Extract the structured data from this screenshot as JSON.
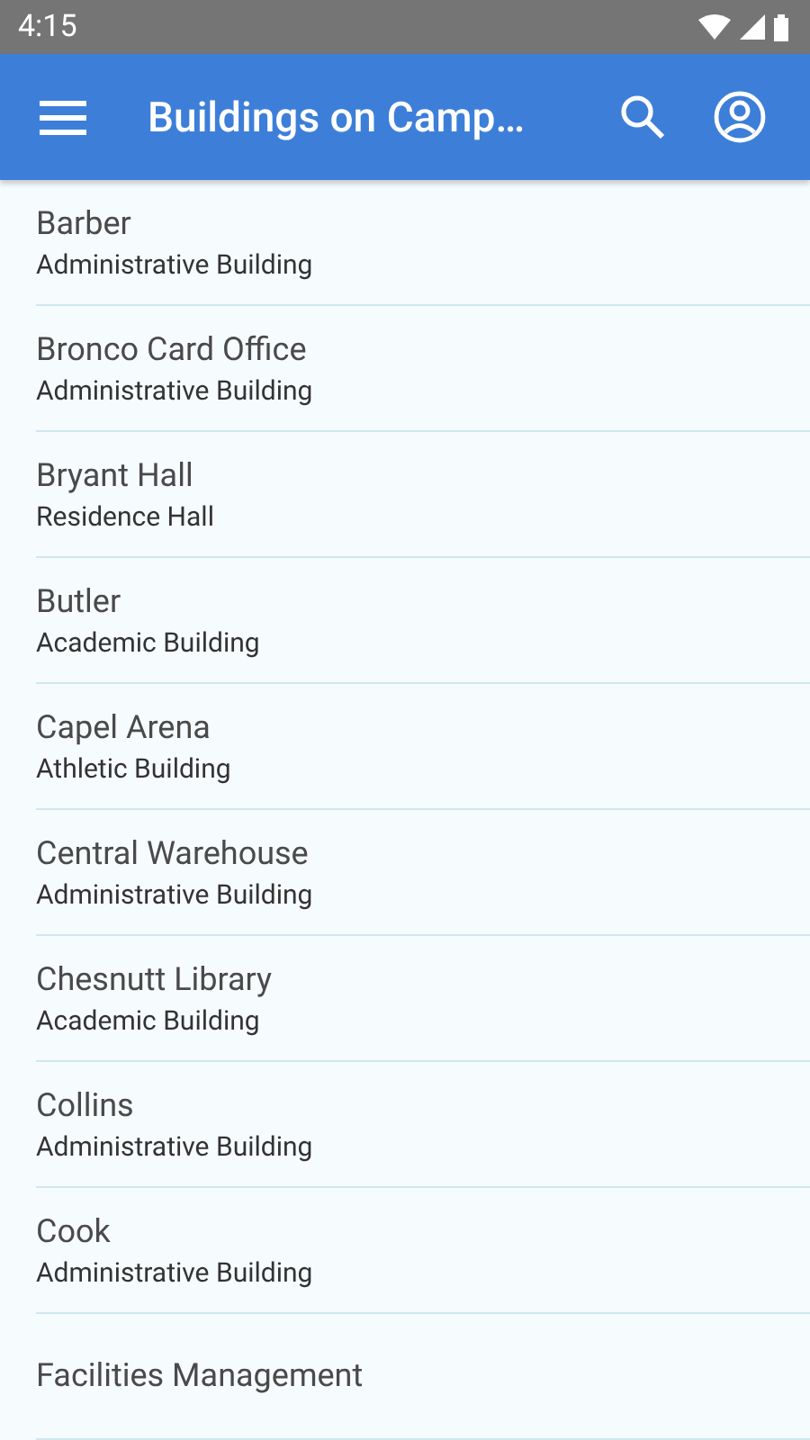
{
  "status_bar": {
    "time": "4:15"
  },
  "app_bar": {
    "title": "Buildings on Camp…"
  },
  "buildings": [
    {
      "name": "Barber",
      "type": "Administrative Building"
    },
    {
      "name": "Bronco Card Office",
      "type": "Administrative Building"
    },
    {
      "name": "Bryant Hall",
      "type": "Residence Hall"
    },
    {
      "name": "Butler",
      "type": "Academic Building"
    },
    {
      "name": "Capel Arena",
      "type": "Athletic Building"
    },
    {
      "name": "Central Warehouse",
      "type": "Administrative Building"
    },
    {
      "name": "Chesnutt Library",
      "type": "Academic Building"
    },
    {
      "name": "Collins",
      "type": "Administrative Building"
    },
    {
      "name": "Cook",
      "type": "Administrative Building"
    },
    {
      "name": "Facilities Management"
    }
  ]
}
